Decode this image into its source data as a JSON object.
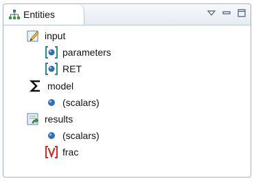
{
  "view": {
    "title": "Entities",
    "title_icon": "entities-tree-icon",
    "controls": [
      "view-menu-icon",
      "minimize-icon",
      "maximize-icon"
    ]
  },
  "tree": {
    "input": {
      "label": "input",
      "icon": "input-edit-icon",
      "children": [
        {
          "label": "parameters",
          "icon": "parameter-vector-icon"
        },
        {
          "label": "RET",
          "icon": "parameter-vector-icon"
        }
      ]
    },
    "model": {
      "label": "model",
      "icon": "sigma-icon",
      "children": [
        {
          "label": "(scalars)",
          "icon": "scalar-dot-icon"
        }
      ]
    },
    "results": {
      "label": "results",
      "icon": "results-icon",
      "children": [
        {
          "label": "(scalars)",
          "icon": "scalar-dot-icon"
        },
        {
          "label": "frac",
          "icon": "variable-vector-icon"
        }
      ]
    }
  },
  "colors": {
    "accent_blue": "#2f6fb5",
    "teal_bracket": "#2a8a8a",
    "red_variable": "#d42a2a",
    "panel_border": "#9fb2c6"
  }
}
